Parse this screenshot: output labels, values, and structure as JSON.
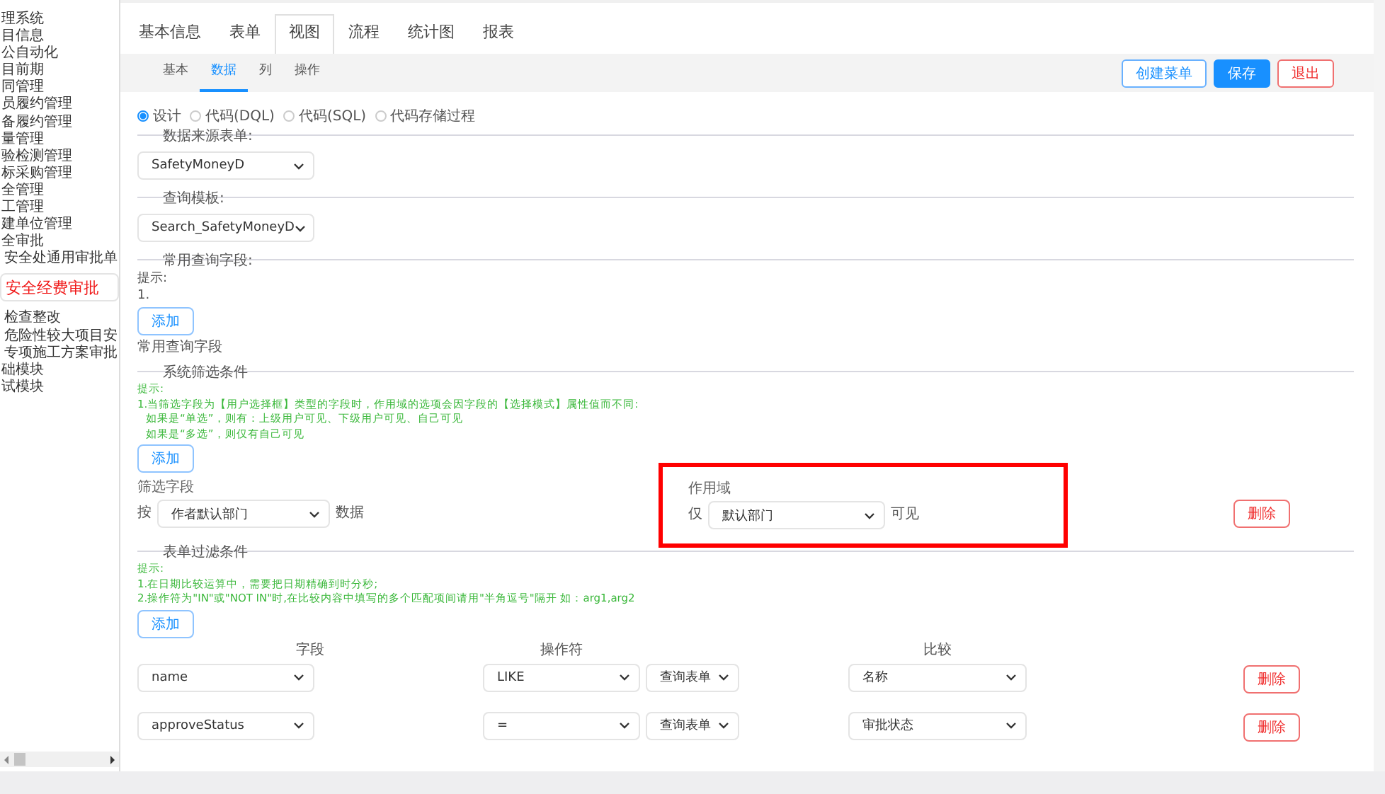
{
  "sidebar": {
    "items": [
      {
        "label": "理系统",
        "selected": false
      },
      {
        "label": "目信息",
        "selected": false
      },
      {
        "label": "公自动化",
        "selected": false
      },
      {
        "label": "目前期",
        "selected": false
      },
      {
        "label": "同管理",
        "selected": false
      },
      {
        "label": "员履约管理",
        "selected": false
      },
      {
        "label": "备履约管理",
        "selected": false
      },
      {
        "label": "量管理",
        "selected": false
      },
      {
        "label": "验检测管理",
        "selected": false
      },
      {
        "label": "标采购管理",
        "selected": false
      },
      {
        "label": "全管理",
        "selected": false
      },
      {
        "label": "工管理",
        "selected": false
      },
      {
        "label": "建单位管理",
        "selected": false
      },
      {
        "label": "全审批",
        "selected": false,
        "expanded": true,
        "children": [
          {
            "label": "安全处通用审批单",
            "selected": false
          },
          {
            "label": "安全经费审批",
            "selected": true
          },
          {
            "label": "检查整改",
            "selected": false
          },
          {
            "label": "危险性较大项目安",
            "selected": false
          },
          {
            "label": "专项施工方案审批",
            "selected": false
          }
        ]
      },
      {
        "label": "础模块",
        "selected": false
      },
      {
        "label": "试模块",
        "selected": false
      }
    ]
  },
  "tabs": [
    {
      "label": "基本信息",
      "selected": false
    },
    {
      "label": "表单",
      "selected": false
    },
    {
      "label": "视图",
      "selected": true
    },
    {
      "label": "流程",
      "selected": false
    },
    {
      "label": "统计图",
      "selected": false
    },
    {
      "label": "报表",
      "selected": false
    }
  ],
  "sub_tabs": [
    {
      "label": "基本",
      "selected": false
    },
    {
      "label": "数据",
      "selected": true
    },
    {
      "label": "列",
      "selected": false
    },
    {
      "label": "操作",
      "selected": false
    }
  ],
  "toolbar_buttons": [
    {
      "label": "创建菜单",
      "kind": "outline"
    },
    {
      "label": "保存",
      "kind": "primary"
    },
    {
      "label": "退出",
      "kind": "danger"
    }
  ],
  "mode_options": [
    {
      "label": "设计",
      "selected": true
    },
    {
      "label": "代码(DQL)",
      "selected": false
    },
    {
      "label": "代码(SQL)",
      "selected": false
    },
    {
      "label": "代码存储过程",
      "selected": false
    }
  ],
  "data_source": {
    "title": "数据来源表单:",
    "value": "SafetyMoneyD"
  },
  "query_template": {
    "title": "查询模板:",
    "value": "Search_SafetyMoneyD"
  },
  "common_fields": {
    "title": "常用查询字段:",
    "hint_lines": [
      "提示:",
      "1."
    ],
    "add_button": "添加",
    "caption": "常用查询字段"
  },
  "system_filter": {
    "title": "系统筛选条件",
    "hint_lines": [
      "提示:",
      "1.当筛选字段为【用户选择框】类型的字段时，作用域的选项会因字段的【选择模式】属性值而不同:",
      "如果是“单选”，则有：上级用户可见、下级用户可见、自己可见",
      "如果是“多选”，则仅有自己可见"
    ],
    "add_button": "添加",
    "field_label": "筛选字段",
    "prefix": "按",
    "field_value": "作者默认部门",
    "suffix": "数据",
    "scope": {
      "label": "作用域",
      "prefix": "仅",
      "value": "默认部门",
      "suffix": "可见",
      "highlighted": true
    },
    "delete_button": "删除"
  },
  "form_filter": {
    "title": "表单过滤条件",
    "hint_lines": [
      "提示:",
      "1.在日期比较运算中，需要把日期精确到时分秒;",
      "2.操作符为\"IN\"或\"NOT IN\"时,在比较内容中填写的多个匹配项间请用\"半角逗号\"隔开 如：arg1,arg2"
    ],
    "add_button": "添加",
    "columns": [
      "字段",
      "操作符",
      "比较"
    ],
    "rows": [
      {
        "field": "name",
        "operator": "LIKE",
        "source": "查询表单",
        "compare": "名称",
        "delete_button": "删除"
      },
      {
        "field": "approveStatus",
        "operator": "=",
        "source": "查询表单",
        "compare": "审批状态",
        "delete_button": "删除"
      }
    ]
  }
}
